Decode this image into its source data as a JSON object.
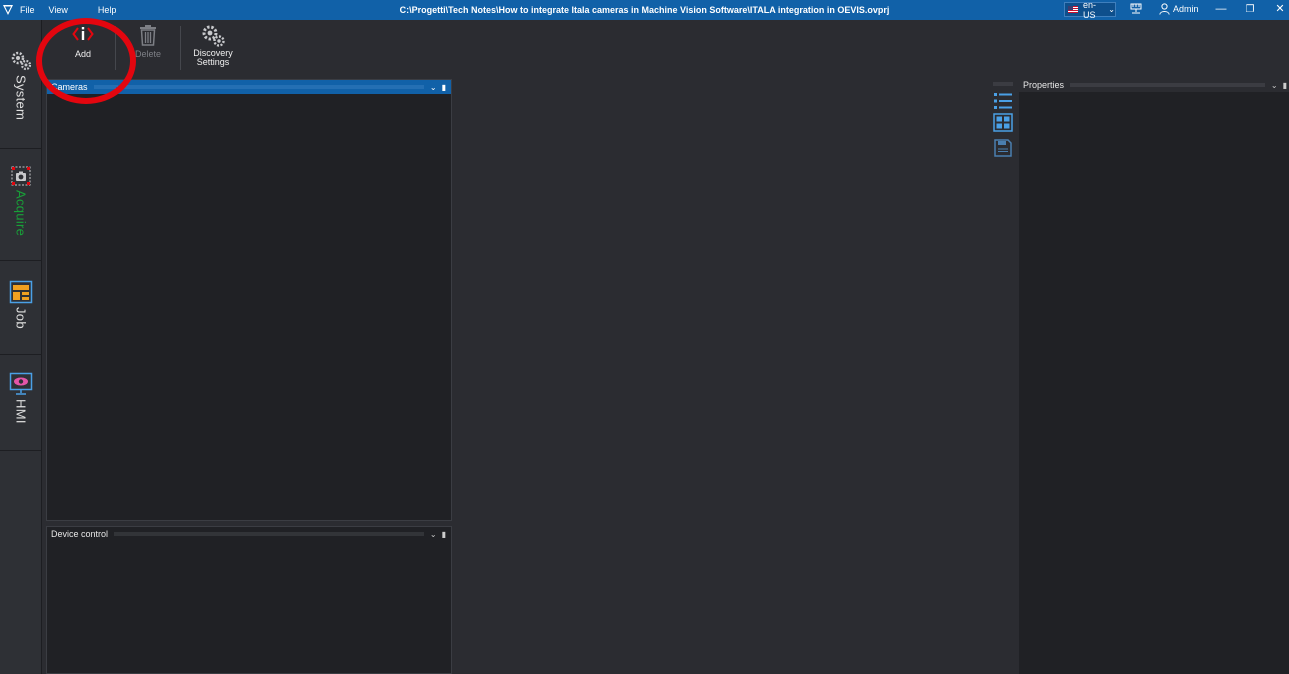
{
  "titlebar": {
    "menus": [
      "File",
      "View",
      "Help"
    ],
    "title": "C:\\Progetti\\Tech Notes\\How to integrate Itala cameras in Machine Vision Software\\ITALA integration in OEVIS.ovprj",
    "language": "en-US",
    "user": "Admin",
    "window_controls": {
      "minimize": "—",
      "restore": "❐",
      "close": "✕"
    }
  },
  "nav": {
    "tabs": [
      {
        "label": "System",
        "icon": "gears-icon"
      },
      {
        "label": "Acquire",
        "icon": "camera-icon",
        "active": true
      },
      {
        "label": "Job",
        "icon": "job-layout-icon"
      },
      {
        "label": "HMI",
        "icon": "monitor-eye-icon"
      }
    ]
  },
  "ribbon": {
    "add_label": "Add",
    "delete_label": "Delete",
    "discovery_label_line1": "Discovery",
    "discovery_label_line2": "Settings"
  },
  "panels": {
    "cameras_title": "Cameras",
    "device_control_title": "Device control",
    "properties_title": "Properties"
  },
  "colors": {
    "accent": "#1161a8",
    "active_tab": "#18a138",
    "highlight": "#e3060f"
  }
}
